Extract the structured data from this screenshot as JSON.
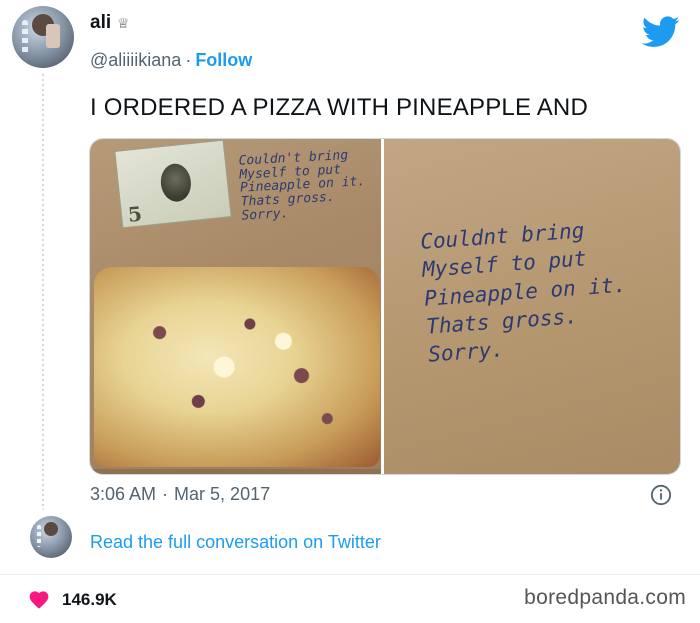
{
  "user": {
    "display_name": "ali",
    "badge_icon": "crown-icon",
    "handle": "@aliiiikiana",
    "separator": "·",
    "follow_label": "Follow"
  },
  "tweet": {
    "text": "I ORDERED A PIZZA WITH PINEAPPLE AND",
    "time": "3:06 AM",
    "separator": "·",
    "date": "Mar 5, 2017"
  },
  "media": {
    "left_photo": {
      "bill_value": "5",
      "note_lines": [
        "Couldn't bring",
        "Myself to put",
        "Pineapple on it.",
        "Thats gross.",
        "Sorry."
      ]
    },
    "right_photo": {
      "note_lines": [
        "Couldnt bring",
        "Myself to put",
        "Pineapple on it.",
        "Thats gross.",
        "Sorry."
      ]
    }
  },
  "footer": {
    "read_more_label": "Read the full conversation on Twitter",
    "likes_count": "146.9K",
    "watermark": "boredpanda.com"
  },
  "colors": {
    "accent": "#1d9bf0",
    "heart": "#f91880",
    "text_primary": "#0f1419",
    "text_secondary": "#536471",
    "note_ink": "#2d3a72"
  }
}
